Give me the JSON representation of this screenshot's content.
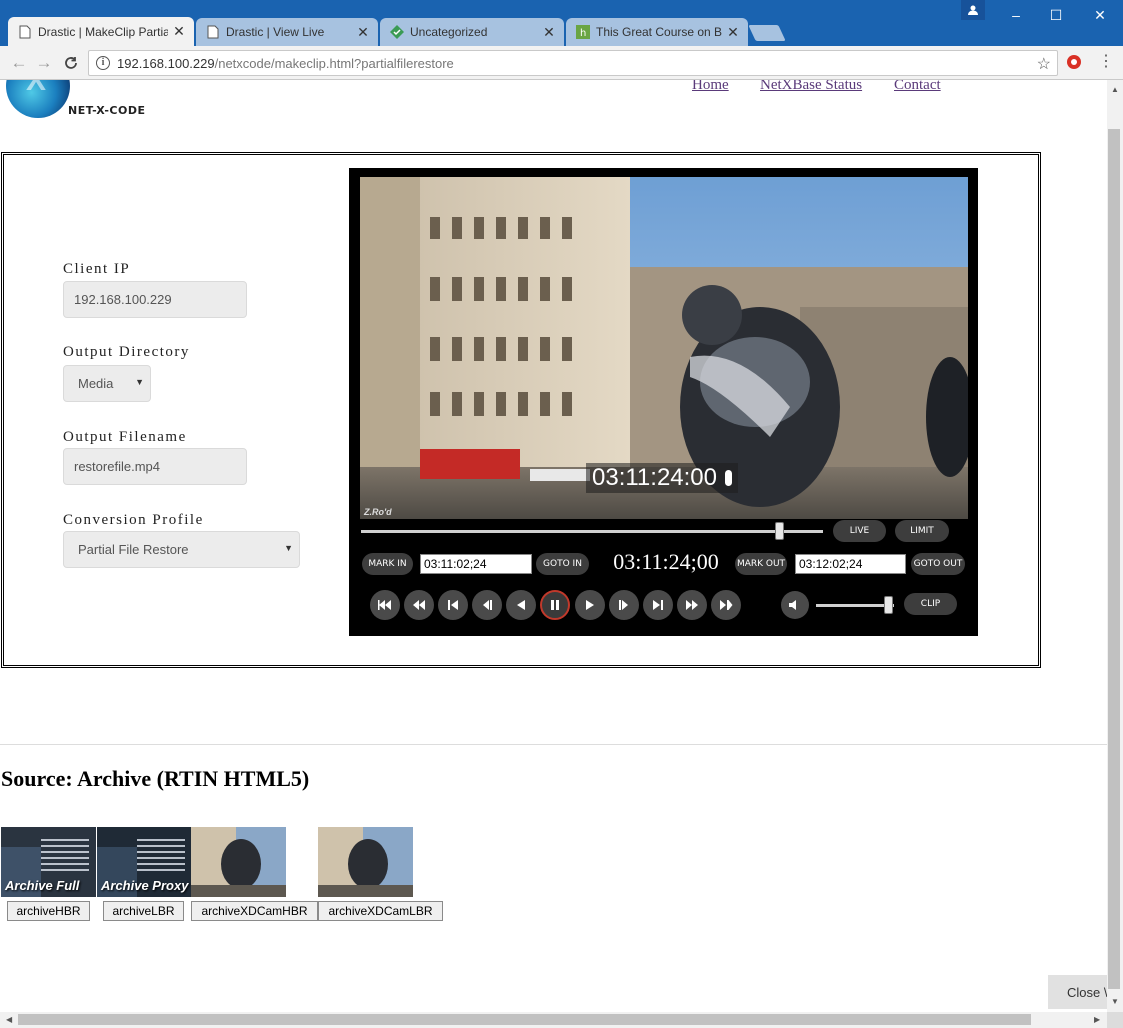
{
  "browser": {
    "tabs": [
      {
        "title": "Drastic | MakeClip Partial",
        "close": "✕"
      },
      {
        "title": "Drastic | View Live",
        "close": "✕"
      },
      {
        "title": "Uncategorized",
        "close": "✕"
      },
      {
        "title": "This Great Course on Bea",
        "close": "✕"
      }
    ],
    "url_host": "192.168.100.229",
    "url_path": "/netxcode/makeclip.html?partialfilerestore",
    "window_controls": {
      "minimize": "–",
      "maximize": "☐",
      "close": "✕"
    }
  },
  "site": {
    "logo_text": "NET-X-CODE",
    "nav": [
      "Home",
      "NetXBase Status",
      "Contact"
    ]
  },
  "form": {
    "client_ip": {
      "label": "Client IP",
      "value": "192.168.100.229"
    },
    "output_directory": {
      "label": "Output Directory",
      "value": "Media"
    },
    "output_filename": {
      "label": "Output Filename",
      "value": "restorefile.mp4"
    },
    "conversion_profile": {
      "label": "Conversion Profile",
      "value": "Partial File Restore"
    }
  },
  "player": {
    "overlay_timecode": "03:11:24:00",
    "video_label": "Z.Ro'd",
    "live_label": "LIVE",
    "limit_label": "LIMIT",
    "mark_in_label": "MARK IN",
    "mark_in_value": "03:11:02;24",
    "goto_in_label": "GOTO IN",
    "current_timecode": "03:11:24;00",
    "mark_out_label": "MARK OUT",
    "mark_out_value": "03:12:02;24",
    "goto_out_label": "GOTO OUT",
    "clip_label": "CLIP",
    "scrub_position": 0.905,
    "volume_level": 0.92,
    "transport_icons": [
      "go-to-start-icon",
      "rewind-icon",
      "skip-back-icon",
      "frame-back-icon",
      "play-reverse-icon",
      "pause-icon",
      "play-icon",
      "frame-forward-icon",
      "skip-forward-icon",
      "fast-forward-icon",
      "go-to-end-icon"
    ]
  },
  "source": {
    "heading": "Source: Archive (RTIN HTML5)",
    "items": [
      {
        "button": "archiveHBR",
        "thumb_text": "Archive Full"
      },
      {
        "button": "archiveLBR",
        "thumb_text": "Archive Proxy"
      },
      {
        "button": "archiveXDCamHBR",
        "thumb_text": ""
      },
      {
        "button": "archiveXDCamLBR",
        "thumb_text": ""
      }
    ]
  },
  "close_button": "Close \\"
}
